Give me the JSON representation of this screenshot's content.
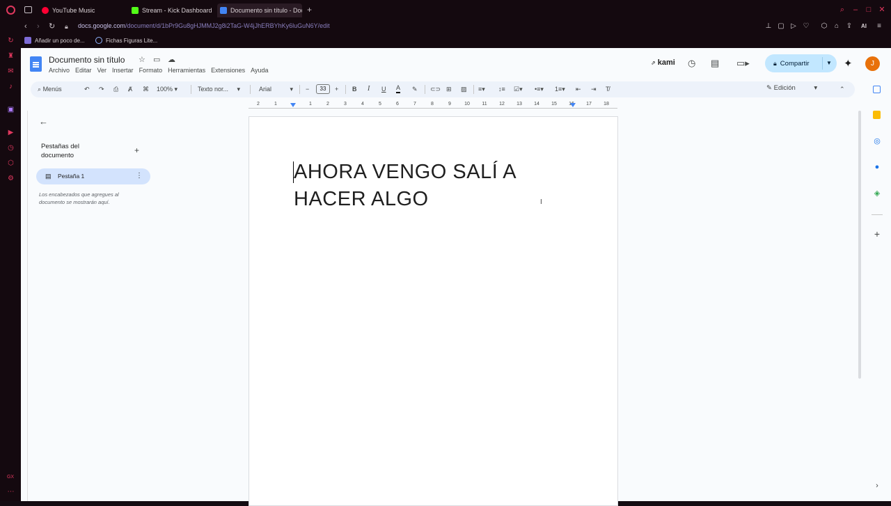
{
  "browser": {
    "tabs": [
      {
        "title": "YouTube Music",
        "active": false,
        "favicon_color": "#ff0033"
      },
      {
        "title": "Stream - Kick Dashboard",
        "active": false,
        "favicon_color": "#53fc18"
      },
      {
        "title": "Documento sin título - Doc",
        "active": true,
        "favicon_color": "#4285f4"
      }
    ],
    "new_tab_label": "+",
    "url": {
      "host": "docs.google.com",
      "path": "/document/d/1bPr9Gu8gHJMMJ2g8i2TaG-W4jJhERBYhKy6luGuN6Y/edit"
    },
    "bookmarks": [
      {
        "label": "Añadir un poco de..."
      },
      {
        "label": "Fichas Figuras Lite..."
      }
    ],
    "ai_label": "AI",
    "sidebar_label": "GX"
  },
  "docs": {
    "title": "Documento sin título",
    "menu": [
      "Archivo",
      "Editar",
      "Ver",
      "Insertar",
      "Formato",
      "Herramientas",
      "Extensiones",
      "Ayuda"
    ],
    "kami_label": "kami",
    "share_label": "Compartir",
    "avatar_initial": "J",
    "toolbar": {
      "menus_label": "Menús",
      "zoom": "100%",
      "style": "Texto nor...",
      "font": "Arial",
      "font_size": "33",
      "mode": "Edición"
    },
    "ruler_labels": [
      "2",
      "1",
      "1",
      "2",
      "3",
      "4",
      "5",
      "6",
      "7",
      "8",
      "9",
      "10",
      "11",
      "12",
      "13",
      "14",
      "15",
      "16",
      "17",
      "18"
    ],
    "tabs_panel": {
      "title": "Pestañas del documento",
      "tab_label": "Pestaña 1",
      "hint": "Los encabezados que agregues al documento se mostrarán aquí."
    },
    "page": {
      "line1": "AHORA VENGO SALÍ A",
      "line2": "HACER ALGO"
    },
    "colors": {
      "accent": "#4285f4",
      "share_bg": "#c2e7ff",
      "opera_red": "#e0385e"
    }
  }
}
